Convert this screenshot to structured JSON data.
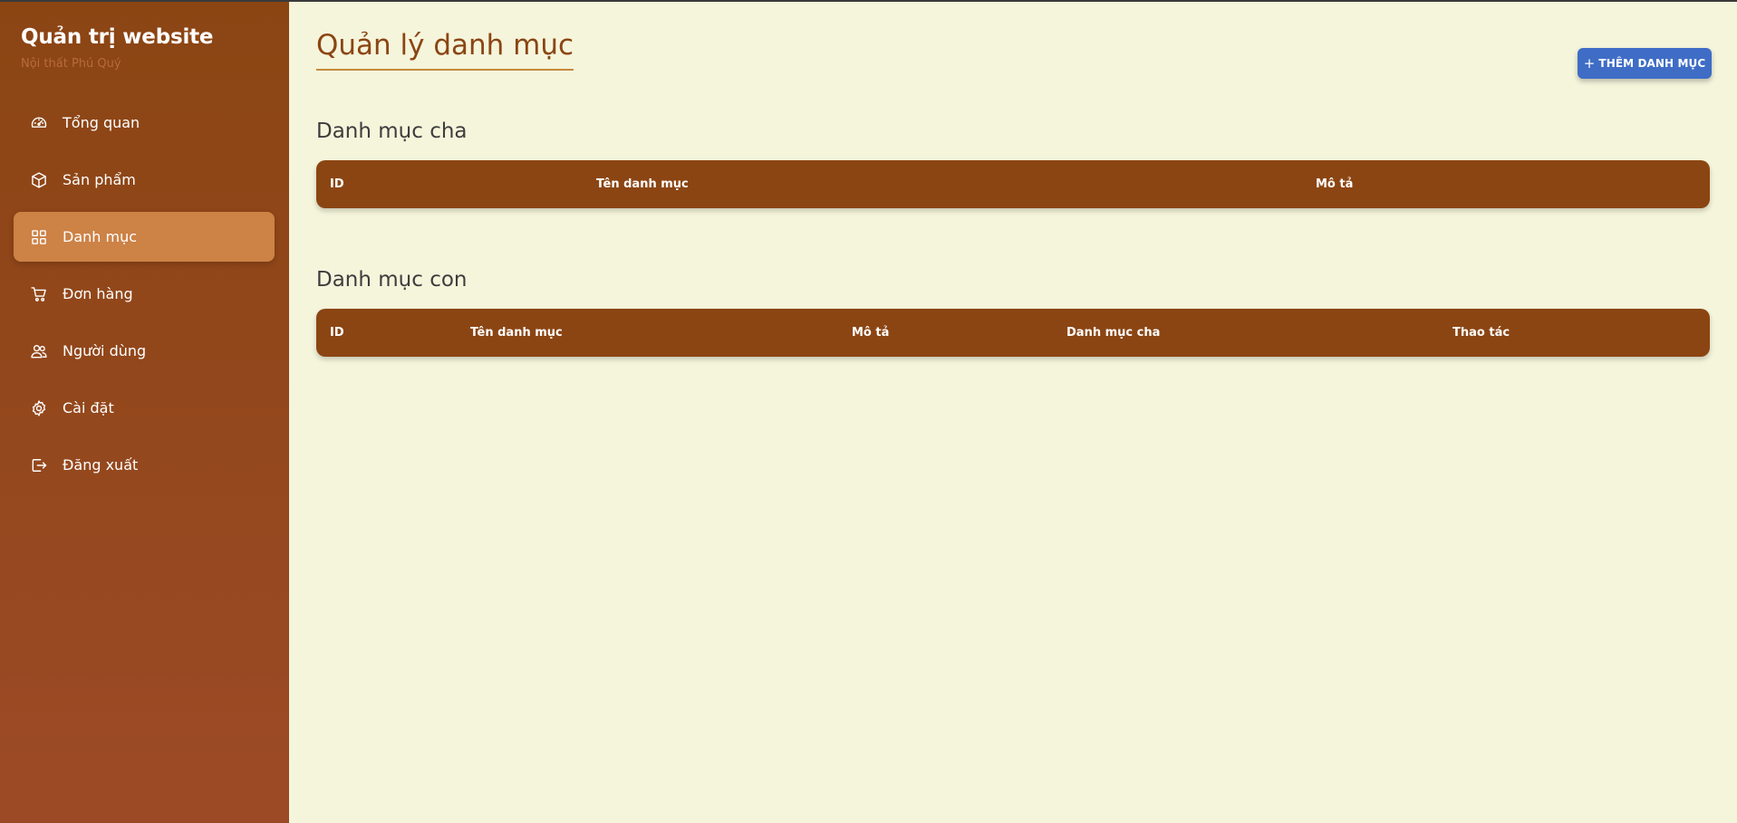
{
  "sidebar": {
    "title": "Quản trị website",
    "subtitle": "Nội thất Phú Quý",
    "items": [
      {
        "label": "Tổng quan",
        "icon": "gauge-icon"
      },
      {
        "label": "Sản phẩm",
        "icon": "box-icon"
      },
      {
        "label": "Danh mục",
        "icon": "grid-icon",
        "active": true
      },
      {
        "label": "Đơn hàng",
        "icon": "cart-icon"
      },
      {
        "label": "Người dùng",
        "icon": "users-icon"
      },
      {
        "label": "Cài đặt",
        "icon": "gear-icon"
      },
      {
        "label": "Đăng xuất",
        "icon": "logout-icon"
      }
    ]
  },
  "main": {
    "title": "Quản lý danh mục",
    "add_button": "THÊM DANH MỤC",
    "parent_section": {
      "title": "Danh mục cha",
      "columns": [
        "ID",
        "Tên danh mục",
        "Mô tả"
      ],
      "rows": []
    },
    "child_section": {
      "title": "Danh mục con",
      "columns": [
        "ID",
        "Tên danh mục",
        "Mô tả",
        "Danh mục cha",
        "Thao tác"
      ],
      "rows": []
    }
  },
  "colors": {
    "sidebar": "#8b4513",
    "active_item": "#cd8246",
    "background": "#f5f5dc",
    "accent_button": "#3f6dc6",
    "table_header": "#8b4513"
  }
}
